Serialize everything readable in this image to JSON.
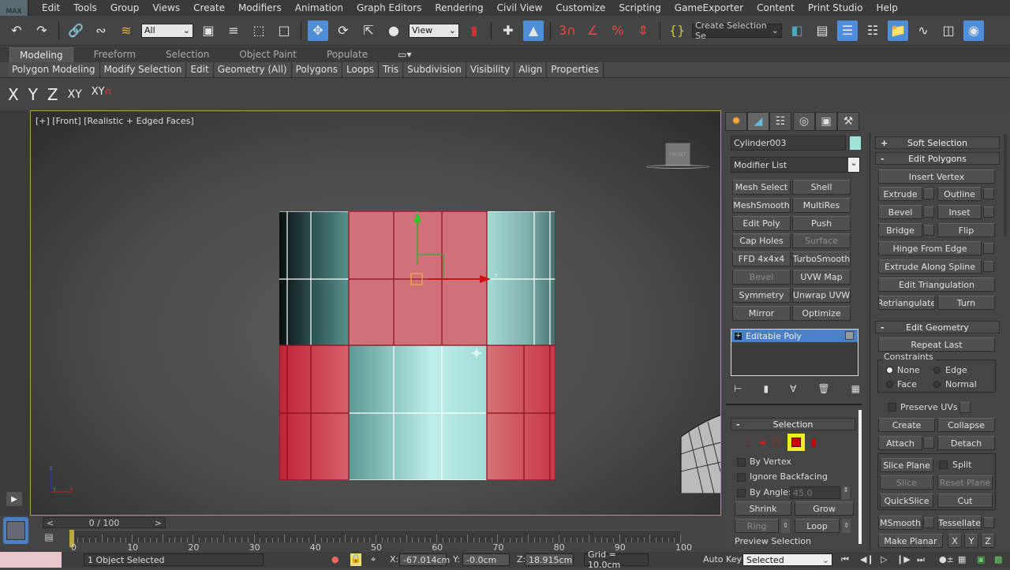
{
  "menubar": {
    "logo": "MAX",
    "items": [
      "Edit",
      "Tools",
      "Group",
      "Views",
      "Create",
      "Modifiers",
      "Animation",
      "Graph Editors",
      "Rendering",
      "Civil View",
      "Customize",
      "Scripting",
      "GameExporter",
      "Content",
      "Print Studio",
      "Help"
    ]
  },
  "toolbar": {
    "selection_filter": "All",
    "reference_coord": "View",
    "named_selection_placeholder": "Create Selection Se",
    "icons": [
      "undo-icon",
      "redo-icon",
      "link-icon",
      "unlink-icon",
      "bind-space-warp-icon",
      "select-object-icon",
      "select-by-name-icon",
      "rect-selection-region-icon",
      "window-crossing-icon",
      "select-move-icon",
      "select-rotate-icon",
      "select-scale-icon",
      "select-place-icon",
      "select-manipulate-icon",
      "keyboard-shortcut-override-icon",
      "snaps-toggle-icon",
      "angle-snap-icon",
      "percent-snap-icon",
      "spinner-snap-icon",
      "edit-named-selection-icon",
      "mirror-icon",
      "align-icon",
      "layer-explorer-icon",
      "toggle-ribbon-icon",
      "curve-editor-icon",
      "schematic-view-icon",
      "material-editor-icon",
      "render-setup-icon"
    ]
  },
  "ribbon": {
    "tabs": [
      "Modeling",
      "Freeform",
      "Selection",
      "Object Paint",
      "Populate"
    ],
    "active_tab": "Modeling",
    "panels": [
      "Polygon Modeling",
      "Modify Selection",
      "Edit",
      "Geometry (All)",
      "Polygons",
      "Loops",
      "Tris",
      "Subdivision",
      "Visibility",
      "Align",
      "Properties"
    ]
  },
  "axis_constraints": [
    "X",
    "Y",
    "Z",
    "XY",
    "XY"
  ],
  "viewport": {
    "label": "[+] [Front] [Realistic + Edged Faces]",
    "viewcube_label": "FRONT",
    "gizmo_x": "x",
    "gizmo_y": "y",
    "axis_tripod": [
      "z",
      "y",
      "x"
    ]
  },
  "command_panel": {
    "object_name": "Cylinder003",
    "object_color": "#9fe3d8",
    "modifier_list": "Modifier List",
    "modifier_buttons": [
      [
        "Mesh Select",
        "Shell"
      ],
      [
        "MeshSmooth",
        "MultiRes"
      ],
      [
        "Edit Poly",
        "Push"
      ],
      [
        "Cap Holes",
        "Surface"
      ],
      [
        "FFD 4x4x4",
        "TurboSmooth"
      ],
      [
        "Bevel",
        "UVW Map"
      ],
      [
        "Symmetry",
        "Unwrap UVW"
      ],
      [
        "Mirror",
        "Optimize"
      ]
    ],
    "stack_item": "Editable Poly",
    "selection": {
      "title": "Selection",
      "by_vertex": "By Vertex",
      "ignore_backfacing": "Ignore Backfacing",
      "by_angle": "By Angle:",
      "angle_value": "45.0",
      "shrink": "Shrink",
      "grow": "Grow",
      "ring": "Ring",
      "loop": "Loop",
      "preview": "Preview Selection"
    },
    "soft_selection": "Soft Selection",
    "edit_polygons": {
      "title": "Edit Polygons",
      "insert_vertex": "Insert Vertex",
      "extrude": "Extrude",
      "outline": "Outline",
      "bevel": "Bevel",
      "inset": "Inset",
      "bridge": "Bridge",
      "flip": "Flip",
      "hinge": "Hinge From Edge",
      "extrude_spline": "Extrude Along Spline",
      "edit_tri": "Edit Triangulation",
      "retri": "Retriangulate",
      "turn": "Turn"
    },
    "edit_geometry": {
      "title": "Edit Geometry",
      "repeat_last": "Repeat Last",
      "constraints": "Constraints",
      "none": "None",
      "edge": "Edge",
      "face": "Face",
      "normal": "Normal",
      "preserve_uvs": "Preserve UVs",
      "create": "Create",
      "collapse": "Collapse",
      "attach": "Attach",
      "detach": "Detach",
      "slice_plane": "Slice Plane",
      "split": "Split",
      "slice": "Slice",
      "reset_plane": "Reset Plane",
      "quickslice": "QuickSlice",
      "cut": "Cut",
      "msmooth": "MSmooth",
      "tessellate": "Tessellate",
      "make_planar": "Make Planar",
      "x": "X",
      "y": "Y",
      "z": "Z"
    }
  },
  "timeline": {
    "frame_display": "0 / 100",
    "prev": "<",
    "next": ">",
    "ticks": [
      "0",
      "10",
      "20",
      "30",
      "40",
      "50",
      "60",
      "70",
      "80",
      "90",
      "100"
    ]
  },
  "status": {
    "selected": "1 Object Selected",
    "x_label": "X:",
    "x_value": "-67.014cm",
    "y_label": "Y:",
    "y_value": "-0.0cm",
    "z_label": "Z:",
    "z_value": "18.915cm",
    "grid": "Grid = 10.0cm",
    "auto_key": "Auto Key",
    "key_filter": "Selected"
  }
}
